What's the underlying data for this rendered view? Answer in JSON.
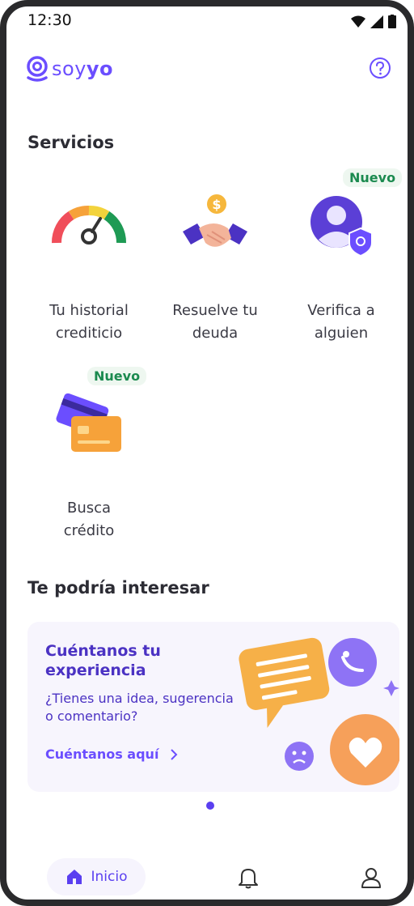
{
  "status_bar": {
    "time": "12:30"
  },
  "header": {
    "logo_prefix": "soy",
    "logo_suffix": "yo",
    "help_icon": "help-circle-icon"
  },
  "sections": {
    "services_title": "Servicios",
    "interest_title": "Te podría interesar"
  },
  "services": [
    {
      "label_line1": "Tu historial",
      "label_line2": "crediticio",
      "icon": "gauge-icon",
      "badge": ""
    },
    {
      "label_line1": "Resuelve tu",
      "label_line2": "deuda",
      "icon": "handshake-coin-icon",
      "badge": ""
    },
    {
      "label_line1": "Verifica a",
      "label_line2": "alguien",
      "icon": "user-shield-icon",
      "badge": "Nuevo"
    },
    {
      "label_line1": "Busca",
      "label_line2": "crédito",
      "icon": "credit-cards-icon",
      "badge": "Nuevo"
    }
  ],
  "banner": {
    "title": "Cuéntanos tu experiencia",
    "subtitle": "¿Tienes una idea, sugerencia o comentario?",
    "link": "Cuéntanos aquí"
  },
  "carousel": {
    "active_index": 1,
    "count": 1
  },
  "bottom_nav": {
    "home_label": "Inicio"
  },
  "colors": {
    "brand": "#6b4eff",
    "badge_green": "#1b8a4f",
    "banner_bg": "#f7f5fd",
    "heading": "#2c2c34"
  }
}
